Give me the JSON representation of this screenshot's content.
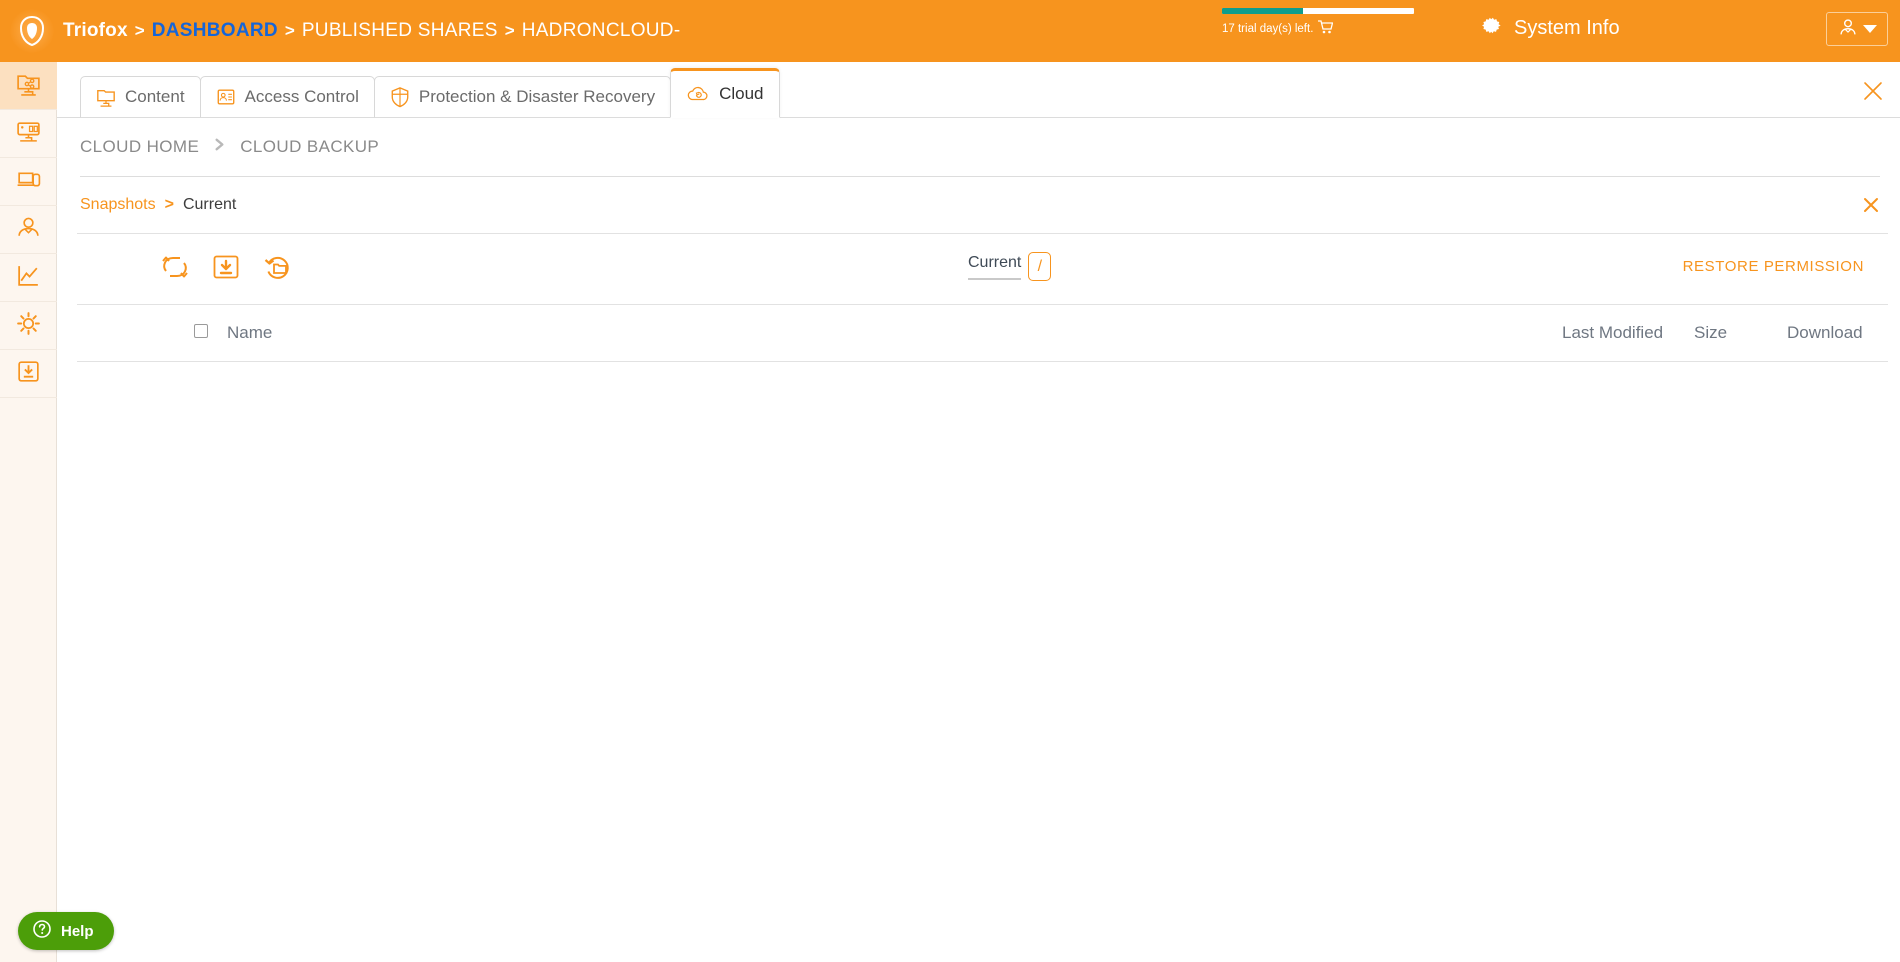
{
  "topbar": {
    "brand": "Triofox",
    "sep": ">",
    "breadcrumbs": [
      {
        "label": "DASHBOARD",
        "style": "link"
      },
      {
        "label": "PUBLISHED SHARES",
        "style": "plain"
      },
      {
        "label": "HADRONCLOUD-",
        "style": "plain"
      }
    ],
    "trial_text": "17 trial day(s) left.",
    "trial_percent": 42,
    "trial_fill_color": "#0f9d8c",
    "cart_icon": "shopping-cart-icon",
    "system_info_label": "System Info",
    "system_info_icon": "gear-icon",
    "user_icon": "user-avatar-icon",
    "accent_color": "#f7941e",
    "link_color": "#1565d8"
  },
  "sidebar": {
    "items": [
      {
        "name": "shared-folders",
        "icon": "shared-folder-icon",
        "active": true
      },
      {
        "name": "dashboard",
        "icon": "monitor-icon",
        "active": false
      },
      {
        "name": "devices",
        "icon": "devices-icon",
        "active": false
      },
      {
        "name": "users",
        "icon": "user-icon",
        "active": false
      },
      {
        "name": "reports",
        "icon": "chart-line-icon",
        "active": false
      },
      {
        "name": "settings",
        "icon": "gear-icon",
        "active": false
      },
      {
        "name": "downloads",
        "icon": "download-box-icon",
        "active": false
      }
    ]
  },
  "tabs": [
    {
      "label": "Content",
      "icon": "content-folder-icon",
      "active": false
    },
    {
      "label": "Access Control",
      "icon": "access-control-icon",
      "active": false
    },
    {
      "label": "Protection & Disaster Recovery",
      "icon": "shield-icon",
      "active": false
    },
    {
      "label": "Cloud",
      "icon": "cloud-sync-icon",
      "active": true
    }
  ],
  "panel": {
    "close_icon": "close-icon",
    "cloud_breadcrumbs": [
      {
        "label": "CLOUD HOME"
      },
      {
        "label": "CLOUD BACKUP"
      }
    ],
    "cloud_breadcrumb_sep": "chevron-right-icon"
  },
  "snapshots": {
    "link_label": "Snapshots",
    "separator": ">",
    "current_label": "Current",
    "close_icon": "close-icon"
  },
  "toolbar": {
    "buttons": [
      {
        "name": "sync-button",
        "icon": "sync-arrows-icon"
      },
      {
        "name": "download-folder-button",
        "icon": "folder-download-icon"
      },
      {
        "name": "restore-folder-button",
        "icon": "restore-folder-icon"
      }
    ],
    "path_current_label": "Current",
    "path_chip_label": "/",
    "restore_permission_label": "RESTORE PERMISSION"
  },
  "table": {
    "select_all_checked": false,
    "columns": {
      "name": "Name",
      "last_modified": "Last Modified",
      "size": "Size",
      "download": "Download"
    },
    "rows": []
  },
  "help": {
    "label": "Help",
    "icon": "question-circle-icon",
    "color": "#4c9e09"
  }
}
